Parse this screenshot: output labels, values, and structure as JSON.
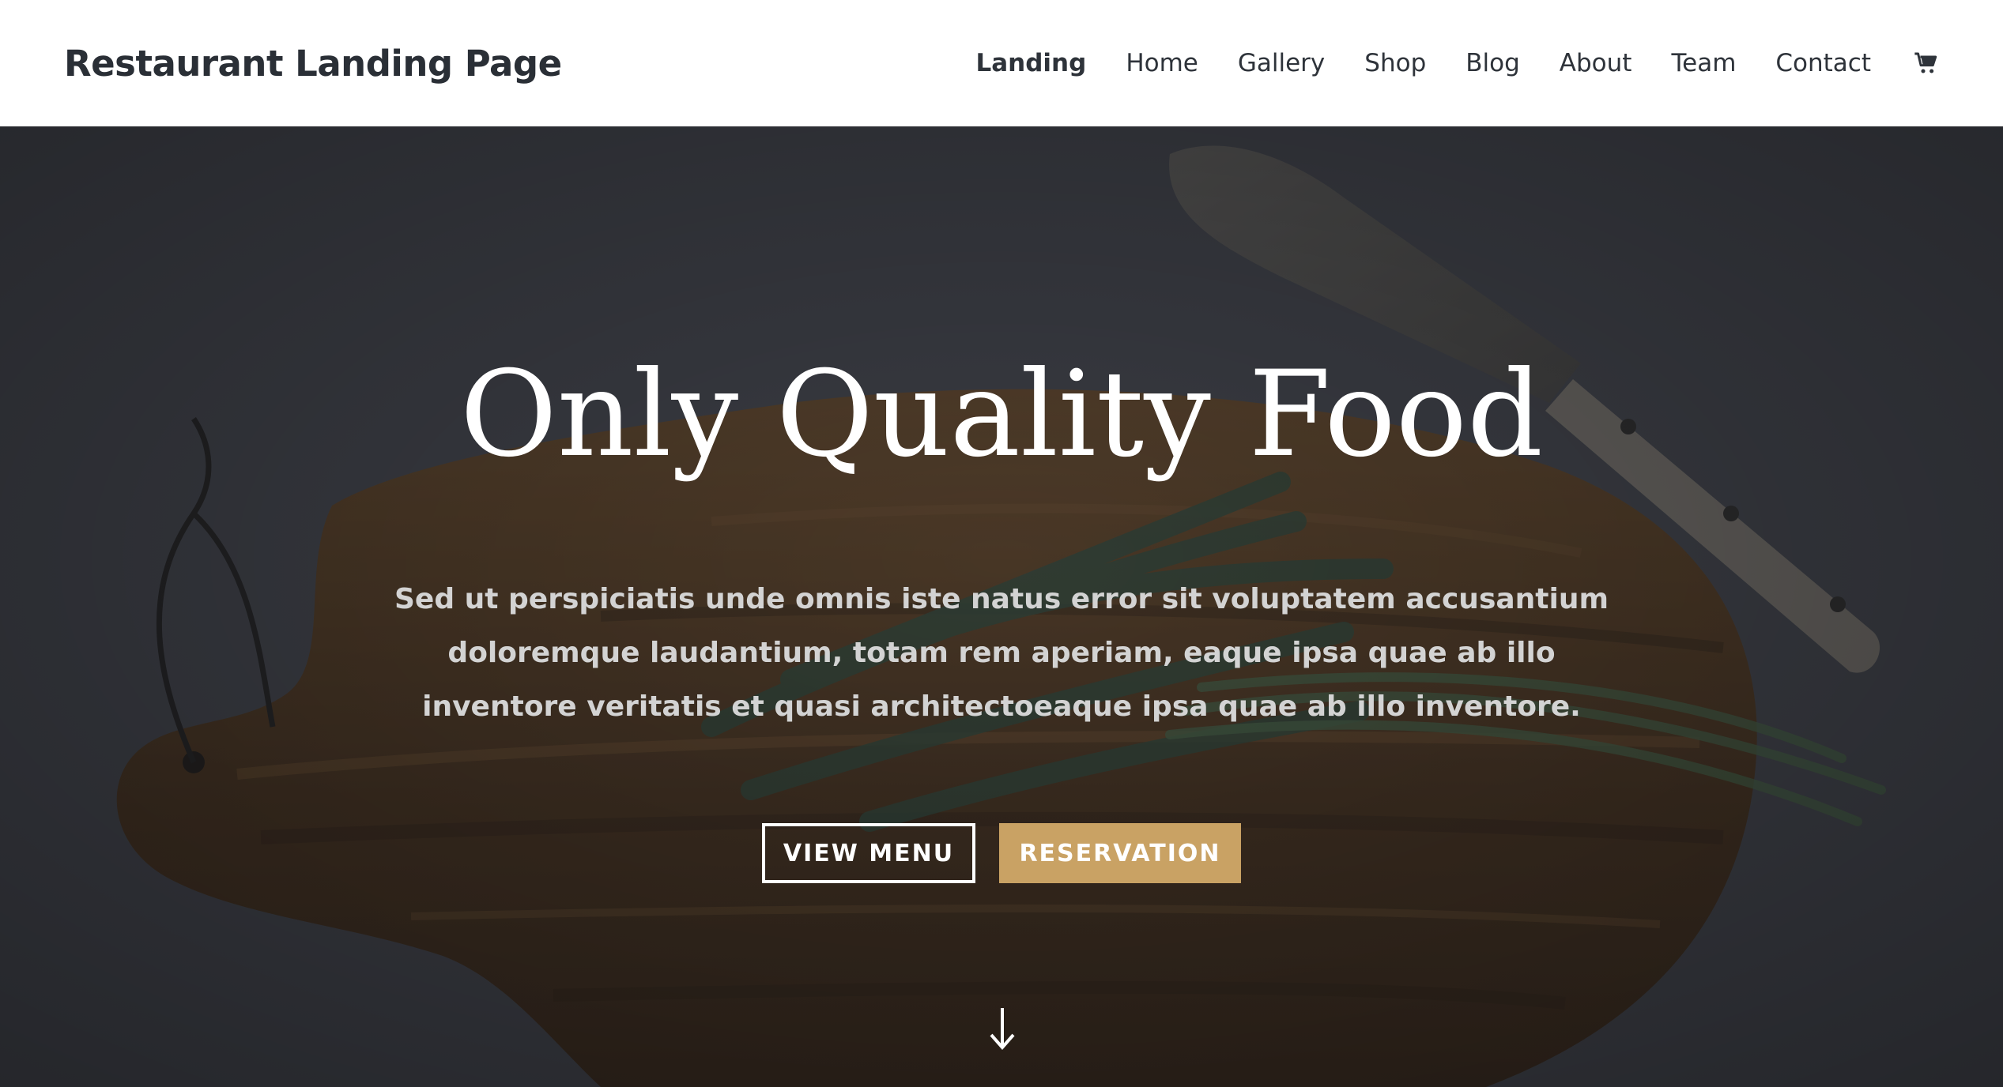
{
  "header": {
    "brand": "Restaurant Landing Page",
    "nav": [
      "Landing",
      "Home",
      "Gallery",
      "Shop",
      "Blog",
      "About",
      "Team",
      "Contact"
    ],
    "active_item": "Landing",
    "cart_icon": "cart-icon"
  },
  "hero": {
    "title": "Only Quality Food",
    "text": "Sed ut perspiciatis unde omnis iste natus error sit voluptatem accusantium doloremque laudantium, totam rem aperiam, eaque ipsa quae ab illo inventore veritatis et quasi architectoeaque ipsa quae ab illo inventore.",
    "buttons": {
      "view_menu": "VIEW MENU",
      "reservation": "RESERVATION"
    },
    "scroll_icon": "arrow-down-icon"
  },
  "colors": {
    "accent": "#c9a264",
    "text_dark": "#2a2f36",
    "hero_overlay": "#3c3f46"
  }
}
